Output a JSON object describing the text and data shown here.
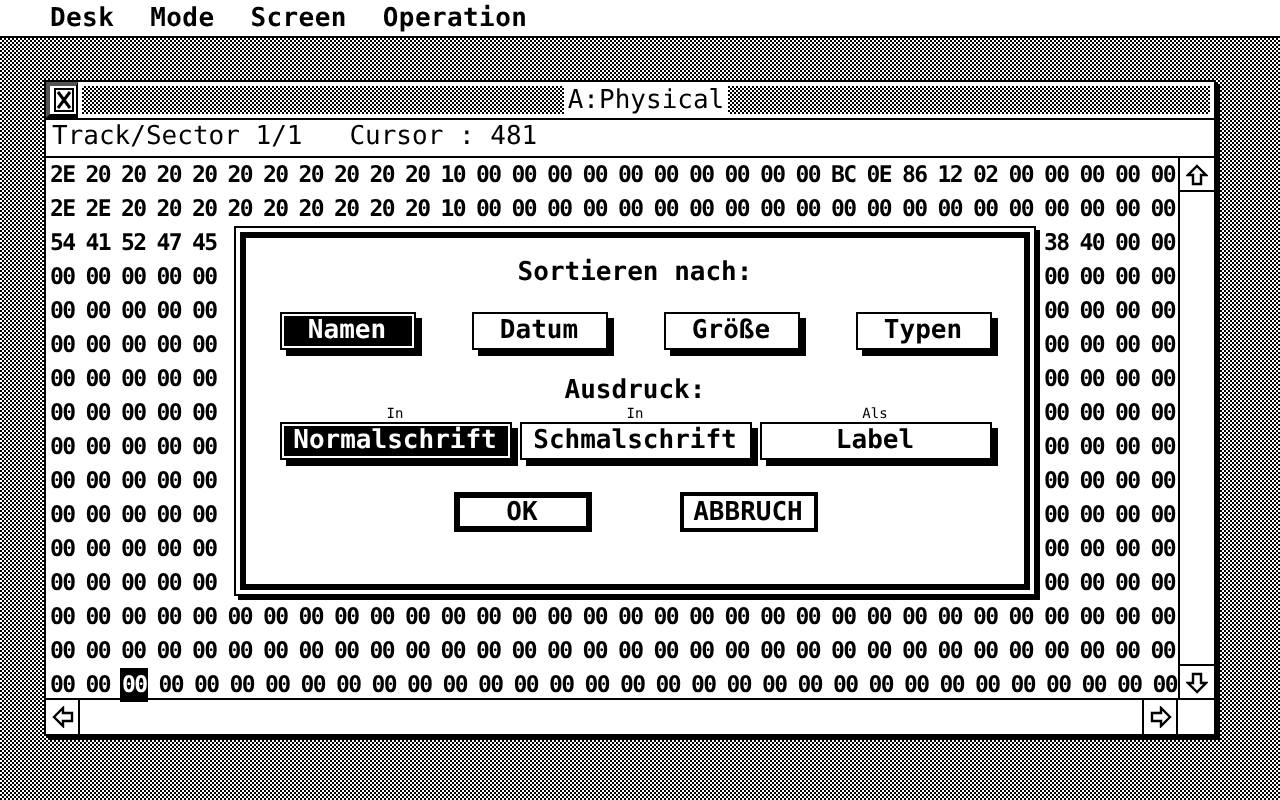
{
  "menu_bar": [
    "Desk",
    "Mode",
    "Screen",
    "Operation"
  ],
  "window": {
    "title": "A:Physical",
    "info": "Track/Sector 1/1   Cursor : 481",
    "hex_rows": [
      {
        "left": "2E 20 20 20 20 20 20 20 20 20 20 10 00 00 00 00 00 00 00 00 00 00 BC 0E 86 12 02 00 00 00 00 00"
      },
      {
        "left": "2E 2E 20 20 20 20 20 20 20 20 20 10 00 00 00 00 00 00 00 00 00 00 00 00 00 00 00 00 00 00 00 00"
      },
      {
        "left": "54 41 52 47 45",
        "right": "38 40 00 00"
      },
      {
        "left": "00 00 00 00 00",
        "right": "00 00 00 00"
      },
      {
        "left": "00 00 00 00 00",
        "right": "00 00 00 00"
      },
      {
        "left": "00 00 00 00 00",
        "right": "00 00 00 00"
      },
      {
        "left": "00 00 00 00 00",
        "right": "00 00 00 00"
      },
      {
        "left": "00 00 00 00 00",
        "right": "00 00 00 00"
      },
      {
        "left": "00 00 00 00 00",
        "right": "00 00 00 00"
      },
      {
        "left": "00 00 00 00 00",
        "right": "00 00 00 00"
      },
      {
        "left": "00 00 00 00 00",
        "right": "00 00 00 00"
      },
      {
        "left": "00 00 00 00 00",
        "right": "00 00 00 00"
      },
      {
        "left": "00 00 00 00 00",
        "right": "00 00 00 00"
      },
      {
        "left": "00 00 00 00 00 00 00 00 00 00 00 00 00 00 00 00 00 00 00 00 00 00 00 00 00 00 00 00 00 00 00 00"
      },
      {
        "left": "00 00 00 00 00 00 00 00 00 00 00 00 00 00 00 00 00 00 00 00 00 00 00 00 00 00 00 00 00 00 00 00"
      },
      {
        "left": "00 00",
        "cursor": "00",
        "right": "00 00 00 00 00 00 00 00 00 00 00 00 00 00 00 00 00 00 00 00 00 00 00 00 00 00 00 00 00"
      }
    ]
  },
  "dialog": {
    "heading": "Sortieren nach:",
    "sort_buttons": [
      {
        "label": "Namen",
        "selected": true
      },
      {
        "label": "Datum",
        "selected": false
      },
      {
        "label": "Größe",
        "selected": false
      },
      {
        "label": "Typen",
        "selected": false
      }
    ],
    "print_heading": "Ausdruck:",
    "print_buttons": [
      {
        "caption": "In",
        "label": "Normalschrift",
        "selected": true
      },
      {
        "caption": "In",
        "label": "Schmalschrift",
        "selected": false
      },
      {
        "caption": "Als",
        "label": "Label",
        "selected": false
      }
    ],
    "actions": [
      {
        "label": "OK",
        "default": true
      },
      {
        "label": "ABBRUCH",
        "default": false
      }
    ]
  }
}
